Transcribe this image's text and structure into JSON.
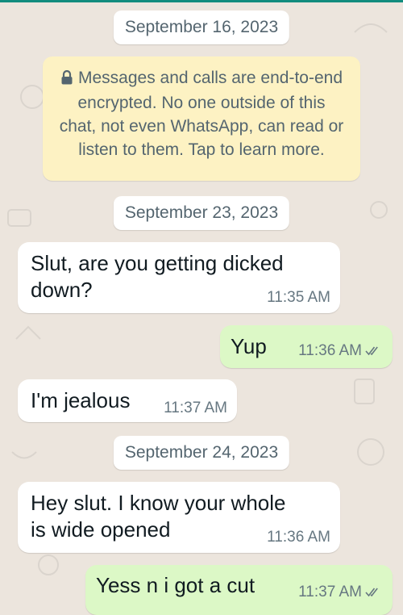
{
  "dates": [
    "September 16, 2023",
    "September 23, 2023",
    "September 24, 2023"
  ],
  "encryption_notice": "Messages and calls are end-to-end encrypted. No one outside of this chat, not even WhatsApp, can read or listen to them. Tap to learn more.",
  "messages": [
    {
      "direction": "incoming",
      "line1": "Slut, are you getting dicked",
      "line2": "down?",
      "time": "11:35 AM"
    },
    {
      "direction": "outgoing",
      "text": "Yup",
      "time": "11:36 AM",
      "status": "read"
    },
    {
      "direction": "incoming",
      "text": "I'm jealous",
      "time": "11:37 AM"
    },
    {
      "direction": "incoming",
      "line1": "Hey slut. I know your whole",
      "line2": "is wide opened",
      "time": "11:36 AM"
    },
    {
      "direction": "outgoing",
      "text": "Yess n i got a cut",
      "time": "11:37 AM",
      "status": "read"
    }
  ],
  "colors": {
    "wallpaper": "#ece5dd",
    "incoming_bubble": "#ffffff",
    "outgoing_bubble": "#dcf8c6",
    "notice_bubble": "#fdf2c3",
    "accent": "#128c7e"
  },
  "icons": {
    "notice": "lock-icon",
    "status": "double-check-icon"
  }
}
